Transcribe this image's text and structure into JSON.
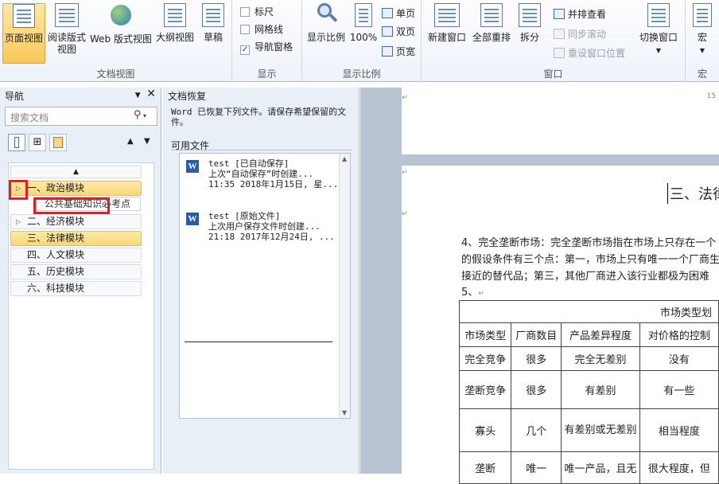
{
  "ribbon": {
    "groups": {
      "doc_views": "文档视图",
      "show": "显示",
      "zoom": "显示比例",
      "window": "窗口",
      "macros": "宏"
    },
    "doc_views": {
      "print_layout": "页面视图",
      "full_screen_reading": "阅读版式视图",
      "web_layout": "Web 版式视图",
      "outline": "大纲视图",
      "draft": "草稿"
    },
    "show": {
      "ruler": "标尺",
      "gridlines": "网格线",
      "nav_pane": "导航窗格",
      "ruler_checked": false,
      "gridlines_checked": false,
      "nav_pane_checked": true
    },
    "zoom": {
      "zoom": "显示比例",
      "hundred": "100%",
      "one_page": "单页",
      "two_pages": "双页",
      "page_width": "页宽"
    },
    "window": {
      "new_window": "新建窗口",
      "arrange_all": "全部重排",
      "split": "拆分",
      "view_side_by_side": "并排查看",
      "sync_scroll": "同步滚动",
      "reset_window_position": "重设窗口位置",
      "switch_windows": "切换窗口"
    },
    "macros": {
      "label": "宏"
    }
  },
  "nav": {
    "title": "导航",
    "search_placeholder": "搜索文档",
    "items": [
      {
        "label": "一、政治模块",
        "highlighted": true
      },
      {
        "label": "二、经济模块",
        "highlighted": false
      },
      {
        "label": "三、法律模块",
        "highlighted": true
      },
      {
        "label": "四、人文模块",
        "highlighted": false
      },
      {
        "label": "五、历史模块",
        "highlighted": false
      },
      {
        "label": "六、科技模块",
        "highlighted": false
      }
    ],
    "sub_item": "公共基础知识必考点"
  },
  "recovery": {
    "title": "文档恢复",
    "description": "Word 已恢复下列文件。请保存希望保留的文件。",
    "available": "可用文件",
    "files": [
      {
        "name": "test  [已自动保存]",
        "line2": "上次“自动保存”时创建...",
        "line3": "11:35 2018年1月15日, 星..."
      },
      {
        "name": "test  [原始文件]",
        "line2": "上次用户保存文件时创建...",
        "line3": "21:18 2017年12月24日, ..."
      }
    ]
  },
  "document": {
    "heading": "三、法律",
    "para_lines": [
      "4、完全垄断市场：完全垄断市场指在市场上只存在一个",
      "的假设条件有三个点：第一，市场上只有唯一一个厂商生",
      "接近的替代品；第三，其他厂商进入该行业都极为困难"
    ],
    "item5": "5、",
    "table": {
      "title": "市场类型划",
      "headers": [
        "市场类型",
        "厂商数目",
        "产品差异程度",
        "对价格的控制"
      ],
      "rows": [
        [
          "完全竞争",
          "很多",
          "完全无差别",
          "没有"
        ],
        [
          "垄断竞争",
          "很多",
          "有差别",
          "有一些"
        ],
        [
          "寡头",
          "几个",
          "有差别或无差别",
          "相当程度"
        ],
        [
          "垄断",
          "唯一",
          "唯一产品，且无",
          "很大程度，但"
        ]
      ]
    }
  }
}
